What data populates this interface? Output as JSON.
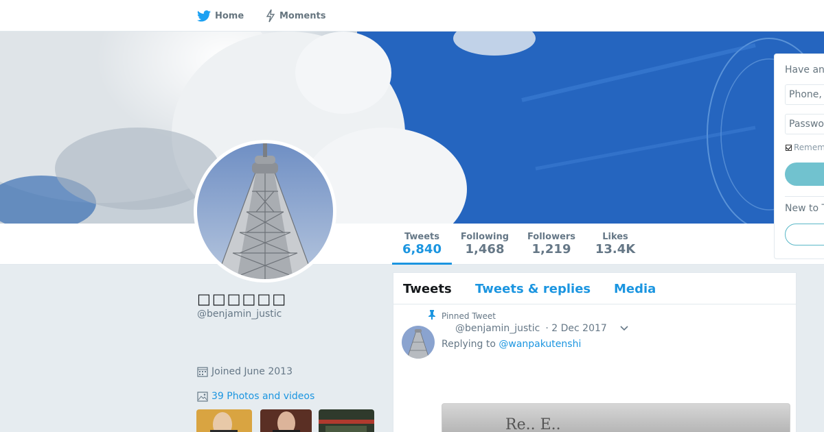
{
  "nav": {
    "home_label": "Home",
    "moments_label": "Moments"
  },
  "profile": {
    "display_name": "□□□□□□",
    "handle": "@benjamin_justic",
    "joined": "Joined June 2013",
    "photos_link": "39 Photos and videos"
  },
  "stats": [
    {
      "label": "Tweets",
      "value": "6,840"
    },
    {
      "label": "Following",
      "value": "1,468"
    },
    {
      "label": "Followers",
      "value": "1,219"
    },
    {
      "label": "Likes",
      "value": "13.4K"
    }
  ],
  "timeline": {
    "tabs": [
      "Tweets",
      "Tweets & replies",
      "Media"
    ],
    "pinned_label": "Pinned Tweet",
    "tweet": {
      "handle": "@benjamin_justic",
      "date": "· 2 Dec 2017",
      "replying_prefix": "Replying to",
      "replying_to": "@wanpakutenshi",
      "media_text": "Re..  E.."
    }
  },
  "login": {
    "title": "Have an",
    "phone_placeholder": "Phone,",
    "password_placeholder": "Passwo",
    "remember_label": "Remem",
    "new_label": "New to T"
  },
  "colors": {
    "accent": "#1b95e0",
    "teal": "#58b7c7",
    "bg": "#e6ecf0"
  },
  "icons": {
    "home": "bird-icon",
    "moments": "lightning-icon"
  }
}
